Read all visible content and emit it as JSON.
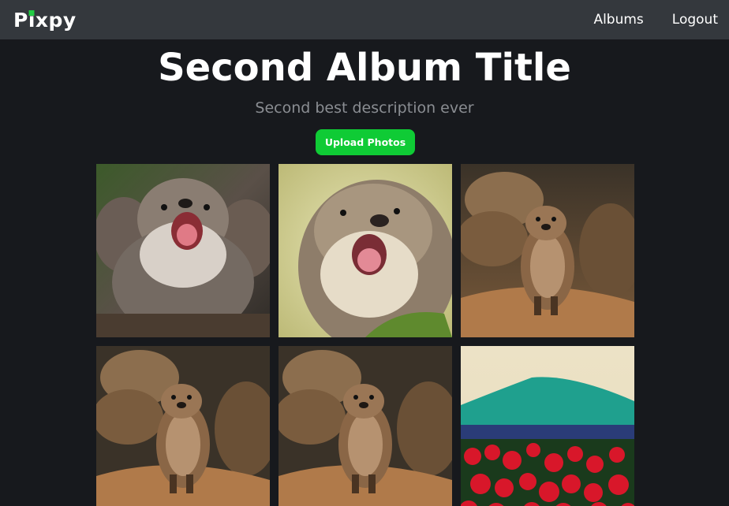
{
  "navbar": {
    "logo": "Pixpy",
    "links": [
      {
        "label": "Albums"
      },
      {
        "label": "Logout"
      }
    ]
  },
  "album": {
    "title": "Second Album Title",
    "description": "Second best description ever",
    "upload_label": "Upload Photos"
  },
  "colors": {
    "navbar_bg": "#34383d",
    "page_bg": "#17191d",
    "accent": "#0fcb35",
    "description_text": "#8a8d92"
  },
  "photos": [
    {
      "subject": "three otters, one yawning"
    },
    {
      "subject": "otter yawning close-up"
    },
    {
      "subject": "otter standing on rock"
    },
    {
      "subject": "otter standing on rock"
    },
    {
      "subject": "otter standing on rock"
    },
    {
      "subject": "red tulips field with mountain"
    }
  ]
}
